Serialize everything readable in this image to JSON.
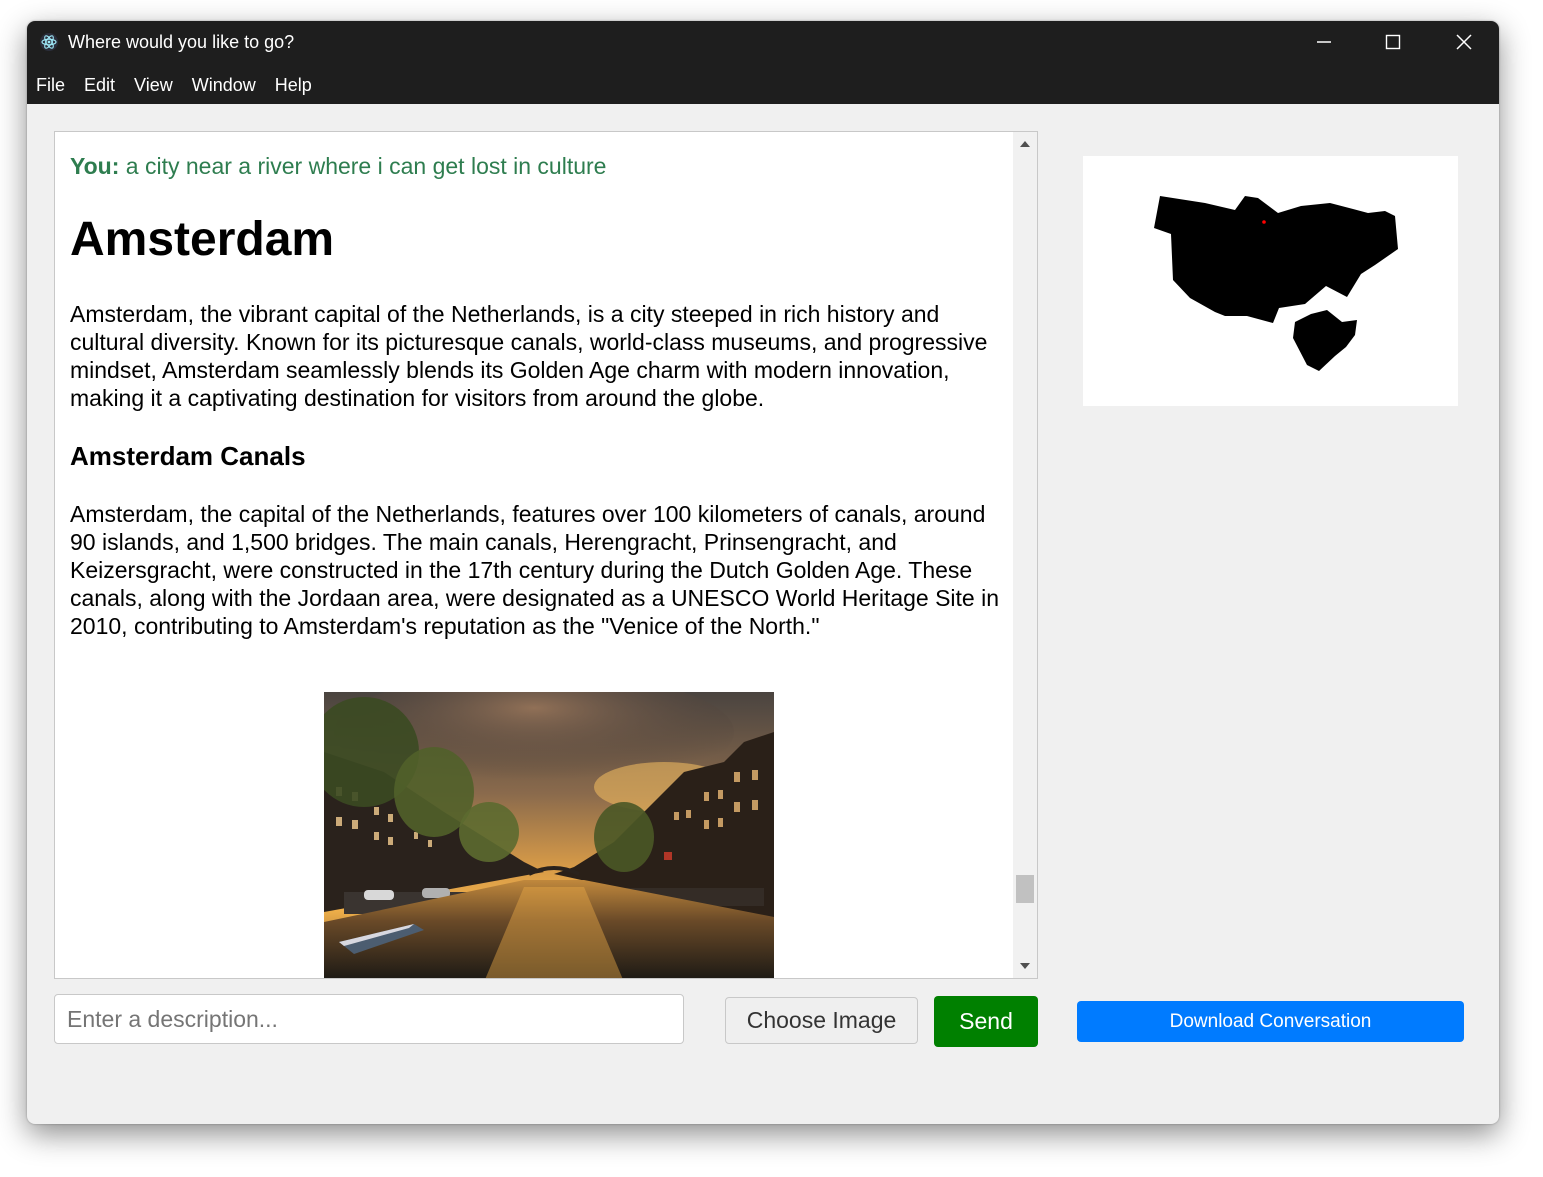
{
  "window": {
    "title": "Where would you like to go?"
  },
  "menu": {
    "items": [
      "File",
      "Edit",
      "View",
      "Window",
      "Help"
    ]
  },
  "chat": {
    "you_label": "You:",
    "you_message": " a city near a river where i can get lost in culture",
    "city_title": "Amsterdam",
    "intro": "Amsterdam, the vibrant capital of the Netherlands, is a city steeped in rich history and cultural diversity. Known for its picturesque canals, world-class museums, and progressive mindset, Amsterdam seamlessly blends its Golden Age charm with modern innovation, making it a captivating destination for visitors from around the globe.",
    "section_title": "Amsterdam Canals",
    "section_text": "Amsterdam, the capital of the Netherlands, features over 100 kilometers of canals, around 90 islands, and 1,500 bridges. The main canals, Herengracht, Prinsengracht, and Keizersgracht, were constructed in the 17th century during the Dutch Golden Age. These canals, along with the Jordaan area, were designated as a UNESCO World Heritage Site in 2010, contributing to Amsterdam's reputation as the \"Venice of the North.\""
  },
  "controls": {
    "input_placeholder": "Enter a description...",
    "choose_image_label": "Choose Image",
    "send_label": "Send",
    "download_label": "Download Conversation"
  },
  "colors": {
    "user_text": "#2e7d4f",
    "send_button": "#008000",
    "download_button": "#007bff",
    "titlebar": "#1e1e1e",
    "map_marker": "#ff0000"
  }
}
